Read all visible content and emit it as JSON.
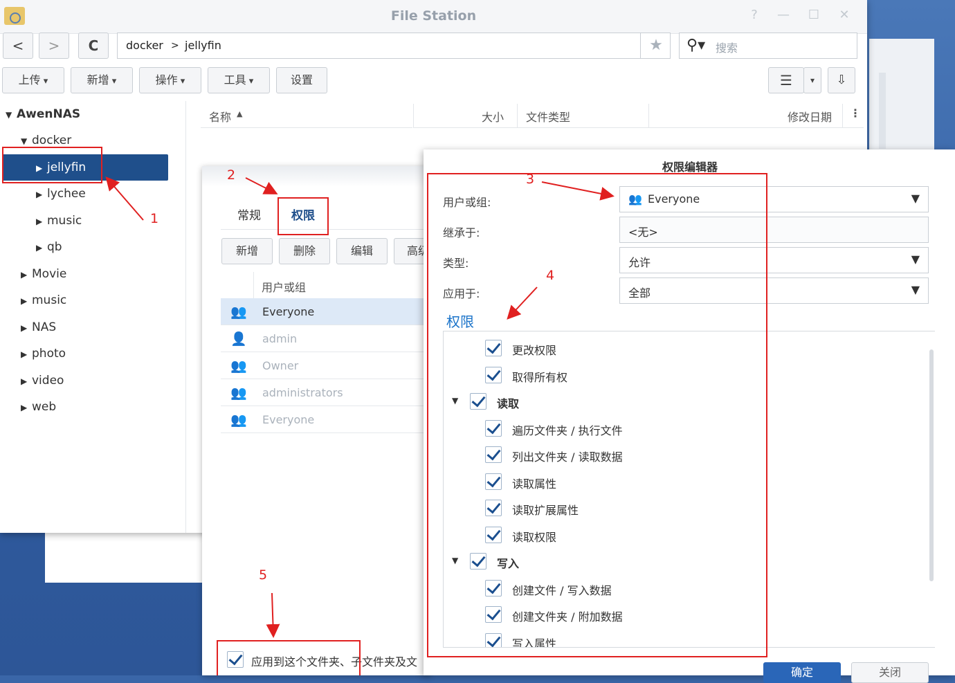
{
  "window": {
    "title": "File Station",
    "help": "?",
    "minimize": "—",
    "maximize": "☐",
    "close": "✕"
  },
  "toolbar": {
    "back": "<",
    "forward": ">",
    "refresh": "C",
    "path": [
      "docker",
      "jellyfin"
    ],
    "path_sep": ">",
    "search_placeholder": "搜索",
    "buttons": [
      "上传",
      "新增",
      "操作",
      "工具",
      "设置"
    ]
  },
  "sidebar": {
    "root": "AwenNAS",
    "items": [
      "docker",
      "jellyfin",
      "lychee",
      "music",
      "qb",
      "Movie",
      "music",
      "NAS",
      "photo",
      "video",
      "web"
    ]
  },
  "file_list": {
    "columns": [
      "名称",
      "大小",
      "文件类型",
      "修改日期"
    ]
  },
  "properties": {
    "tabs": [
      "常规",
      "权限"
    ],
    "buttons": [
      "新增",
      "删除",
      "编辑",
      "高级"
    ],
    "column": "用户或组",
    "rows": [
      "Everyone",
      "admin",
      "Owner",
      "administrators",
      "Everyone"
    ],
    "apply_label": "应用到这个文件夹、子文件夹及文"
  },
  "editor": {
    "title": "权限编辑器",
    "labels": {
      "user": "用户或组:",
      "inherit": "继承于:",
      "type": "类型:",
      "apply": "应用于:"
    },
    "values": {
      "user": "Everyone",
      "inherit": "<无>",
      "type": "允许",
      "apply": "全部"
    },
    "section": "权限",
    "perms": {
      "change": "更改权限",
      "own": "取得所有权",
      "read": "读取",
      "read_items": [
        "遍历文件夹 / 执行文件",
        "列出文件夹 / 读取数据",
        "读取属性",
        "读取扩展属性",
        "读取权限"
      ],
      "write": "写入",
      "write_items": [
        "创建文件 / 写入数据",
        "创建文件夹 / 附加数据",
        "写入属性"
      ]
    },
    "ok": "确定",
    "close": "关闭"
  },
  "annotations": [
    "1",
    "2",
    "3",
    "4",
    "5"
  ]
}
